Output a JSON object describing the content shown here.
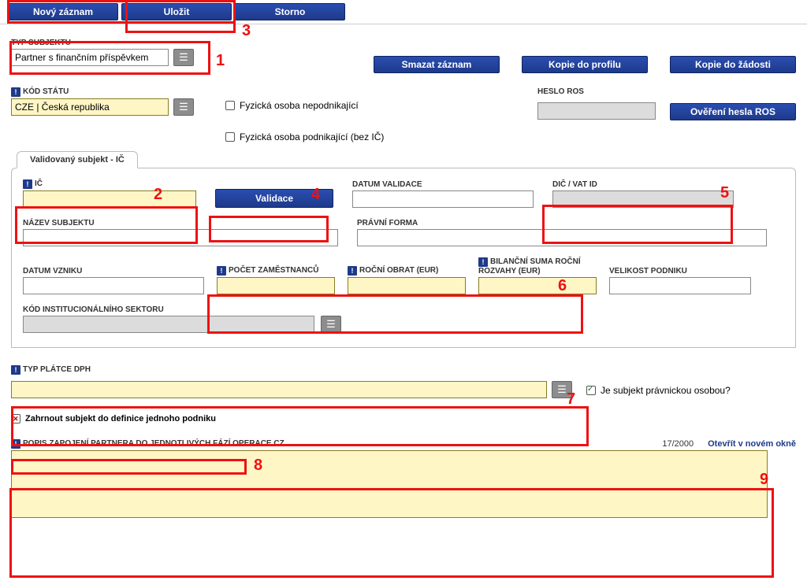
{
  "toolbar": {
    "new_record": "Nový záznam",
    "save": "Uložit",
    "cancel": "Storno"
  },
  "typ_subjektu": {
    "label": "TYP SUBJEKTU",
    "value": "Partner s finančním příspěvkem"
  },
  "right_actions": {
    "delete": "Smazat záznam",
    "copy_profile": "Kopie do profilu",
    "copy_request": "Kopie do žádosti"
  },
  "kod_statu": {
    "label": "KÓD STÁTU",
    "value": "CZE | Česká republika"
  },
  "fyzicka_nepodnikajici": "Fyzická osoba nepodnikající",
  "fyzicka_podnikajici": "Fyzická osoba podnikající (bez IČ)",
  "heslo_ros_label": "HESLO ROS",
  "heslo_ros_value": "",
  "overeni_btn": "Ověření hesla ROS",
  "tab_title": "Validovaný subjekt - IČ",
  "ic": {
    "label": "IČ",
    "value": ""
  },
  "validace_btn": "Validace",
  "datum_validace": {
    "label": "DATUM VALIDACE",
    "value": ""
  },
  "dic": {
    "label": "DIČ / VAT ID",
    "value": ""
  },
  "nazev": {
    "label": "NÁZEV SUBJEKTU",
    "value": ""
  },
  "pravni_forma": {
    "label": "PRÁVNÍ FORMA",
    "value": ""
  },
  "datum_vzniku": {
    "label": "DATUM VZNIKU",
    "value": ""
  },
  "pocet_zam": {
    "label": "POČET ZAMĚSTNANCŮ",
    "value": ""
  },
  "rocni_obrat": {
    "label": "ROČNÍ OBRAT (EUR)",
    "value": ""
  },
  "bilancni": {
    "label": "BILANČNÍ SUMA ROČNÍ ROZVAHY (EUR)",
    "value": ""
  },
  "velikost": {
    "label": "VELIKOST PODNIKU",
    "value": ""
  },
  "sektor": {
    "label": "KÓD INSTITUCIONÁLNÍHO SEKTORU",
    "value": ""
  },
  "typ_platce": {
    "label": "TYP PLÁTCE DPH",
    "value": ""
  },
  "je_pravnicka": "Je subjekt právnickou osobou?",
  "zahrnout": "Zahrnout subjekt do definice jednoho podniku",
  "popis": {
    "label": "POPIS ZAPOJENÍ PARTNERA DO JEDNOTLIVÝCH FÁZÍ OPERACE CZ",
    "counter": "17/2000",
    "open_link": "Otevřít v novém okně",
    "value": ""
  },
  "annot_nums": {
    "n1": "1",
    "n2": "2",
    "n3": "3",
    "n4": "4",
    "n5": "5",
    "n6": "6",
    "n7": "7",
    "n8": "8",
    "n9": "9"
  }
}
